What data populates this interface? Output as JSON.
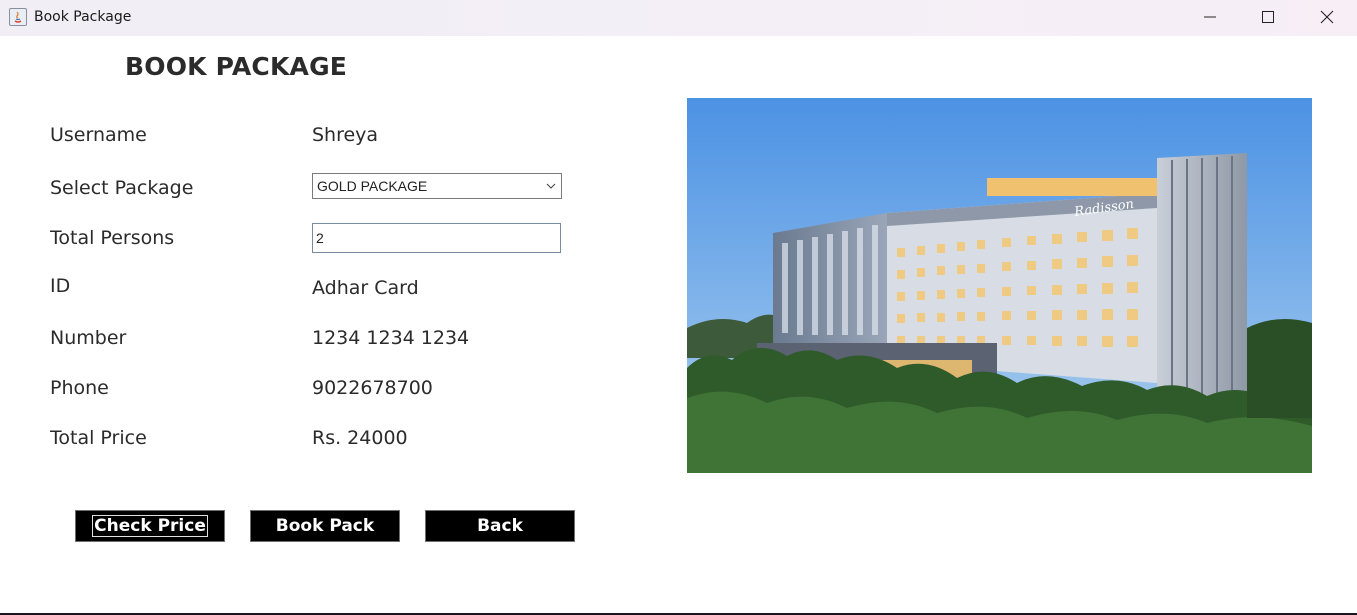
{
  "window": {
    "title": "Book Package",
    "controls": [
      "minimize-icon",
      "maximize-icon",
      "close-icon"
    ]
  },
  "form": {
    "heading": "BOOK PACKAGE",
    "username_label": "Username",
    "username_value": "Shreya",
    "package_label": "Select Package",
    "package_selected": "GOLD PACKAGE",
    "persons_label": "Total Persons",
    "persons_value": "2",
    "id_label": "ID",
    "id_value": "Adhar Card",
    "number_label": "Number",
    "number_value": "1234 1234 1234",
    "phone_label": "Phone",
    "phone_value": "9022678700",
    "price_label": "Total Price",
    "price_value": "Rs. 24000"
  },
  "buttons": {
    "check_price": "Check Price",
    "book_pack": "Book Pack",
    "back": "Back"
  },
  "image": {
    "sign_text": "Radisson"
  },
  "colors": {
    "button_bg": "#000000",
    "button_text": "#ffffff",
    "sky_top": "#4f97e6",
    "sky_bottom": "#a8cdf0"
  }
}
